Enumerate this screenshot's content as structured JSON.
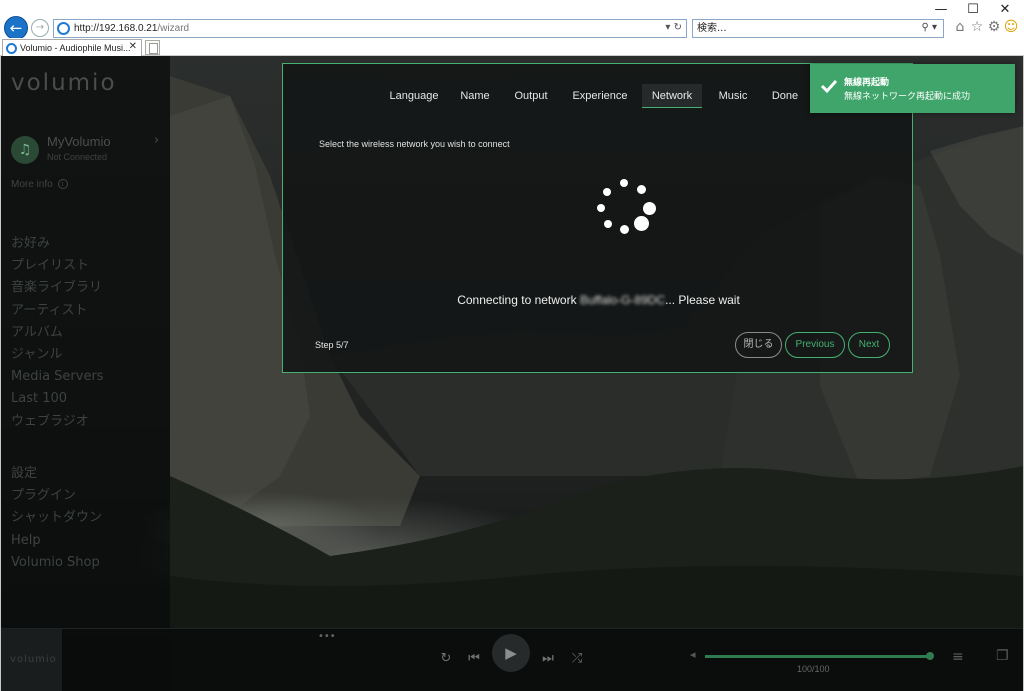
{
  "window": {
    "minimize": "—",
    "maximize": "☐",
    "close": "✕"
  },
  "browser": {
    "url_host": "http://192.168.0.21",
    "url_path": "/wizard",
    "address_controls": "▾ ↻",
    "search_placeholder": "検索...",
    "search_controls": "⚲ ▾",
    "tab_title": "Volumio - Audiophile Musi...",
    "tab_close": "✕",
    "toolbar_icons": [
      "home-icon",
      "favorites-icon",
      "settings-gear-icon",
      "smiley-feedback-icon"
    ]
  },
  "sidebar": {
    "logo": "volumio",
    "device_name": "MyVolumio",
    "device_status": "Not Connected",
    "more_info": "More info",
    "nav_main": [
      "お好み",
      "プレイリスト",
      "音楽ライブラリ",
      "アーティスト",
      "アルバム",
      "ジャンル",
      "Media Servers",
      "Last 100",
      "ウェブラジオ"
    ],
    "nav_secondary": [
      "設定",
      "プラグイン",
      "シャットダウン",
      "Help",
      "Volumio Shop"
    ]
  },
  "wizard": {
    "steps": [
      "Language",
      "Name",
      "Output",
      "Experience",
      "Network",
      "Music",
      "Done"
    ],
    "active_step": "Network",
    "subtitle": "Select the wireless network you wish to connect",
    "status_prefix": "Connecting to network ",
    "status_network": "Buffalo-G-89DC",
    "status_suffix": "... Please wait",
    "step_counter": "Step 5/7",
    "close_label": "閉じる",
    "previous_label": "Previous",
    "next_label": "Next",
    "accent_color": "#45b071"
  },
  "toast": {
    "title": "無線再起動",
    "message": "無線ネットワーク再起動に成功",
    "color": "#3fa56a"
  },
  "player": {
    "art_logo": "volumio",
    "dots": "•••",
    "controls": [
      "repeat-icon",
      "previous-track-icon",
      "play-icon",
      "next-track-icon",
      "shuffle-icon"
    ],
    "volume": 100,
    "volume_label": "100/100"
  }
}
